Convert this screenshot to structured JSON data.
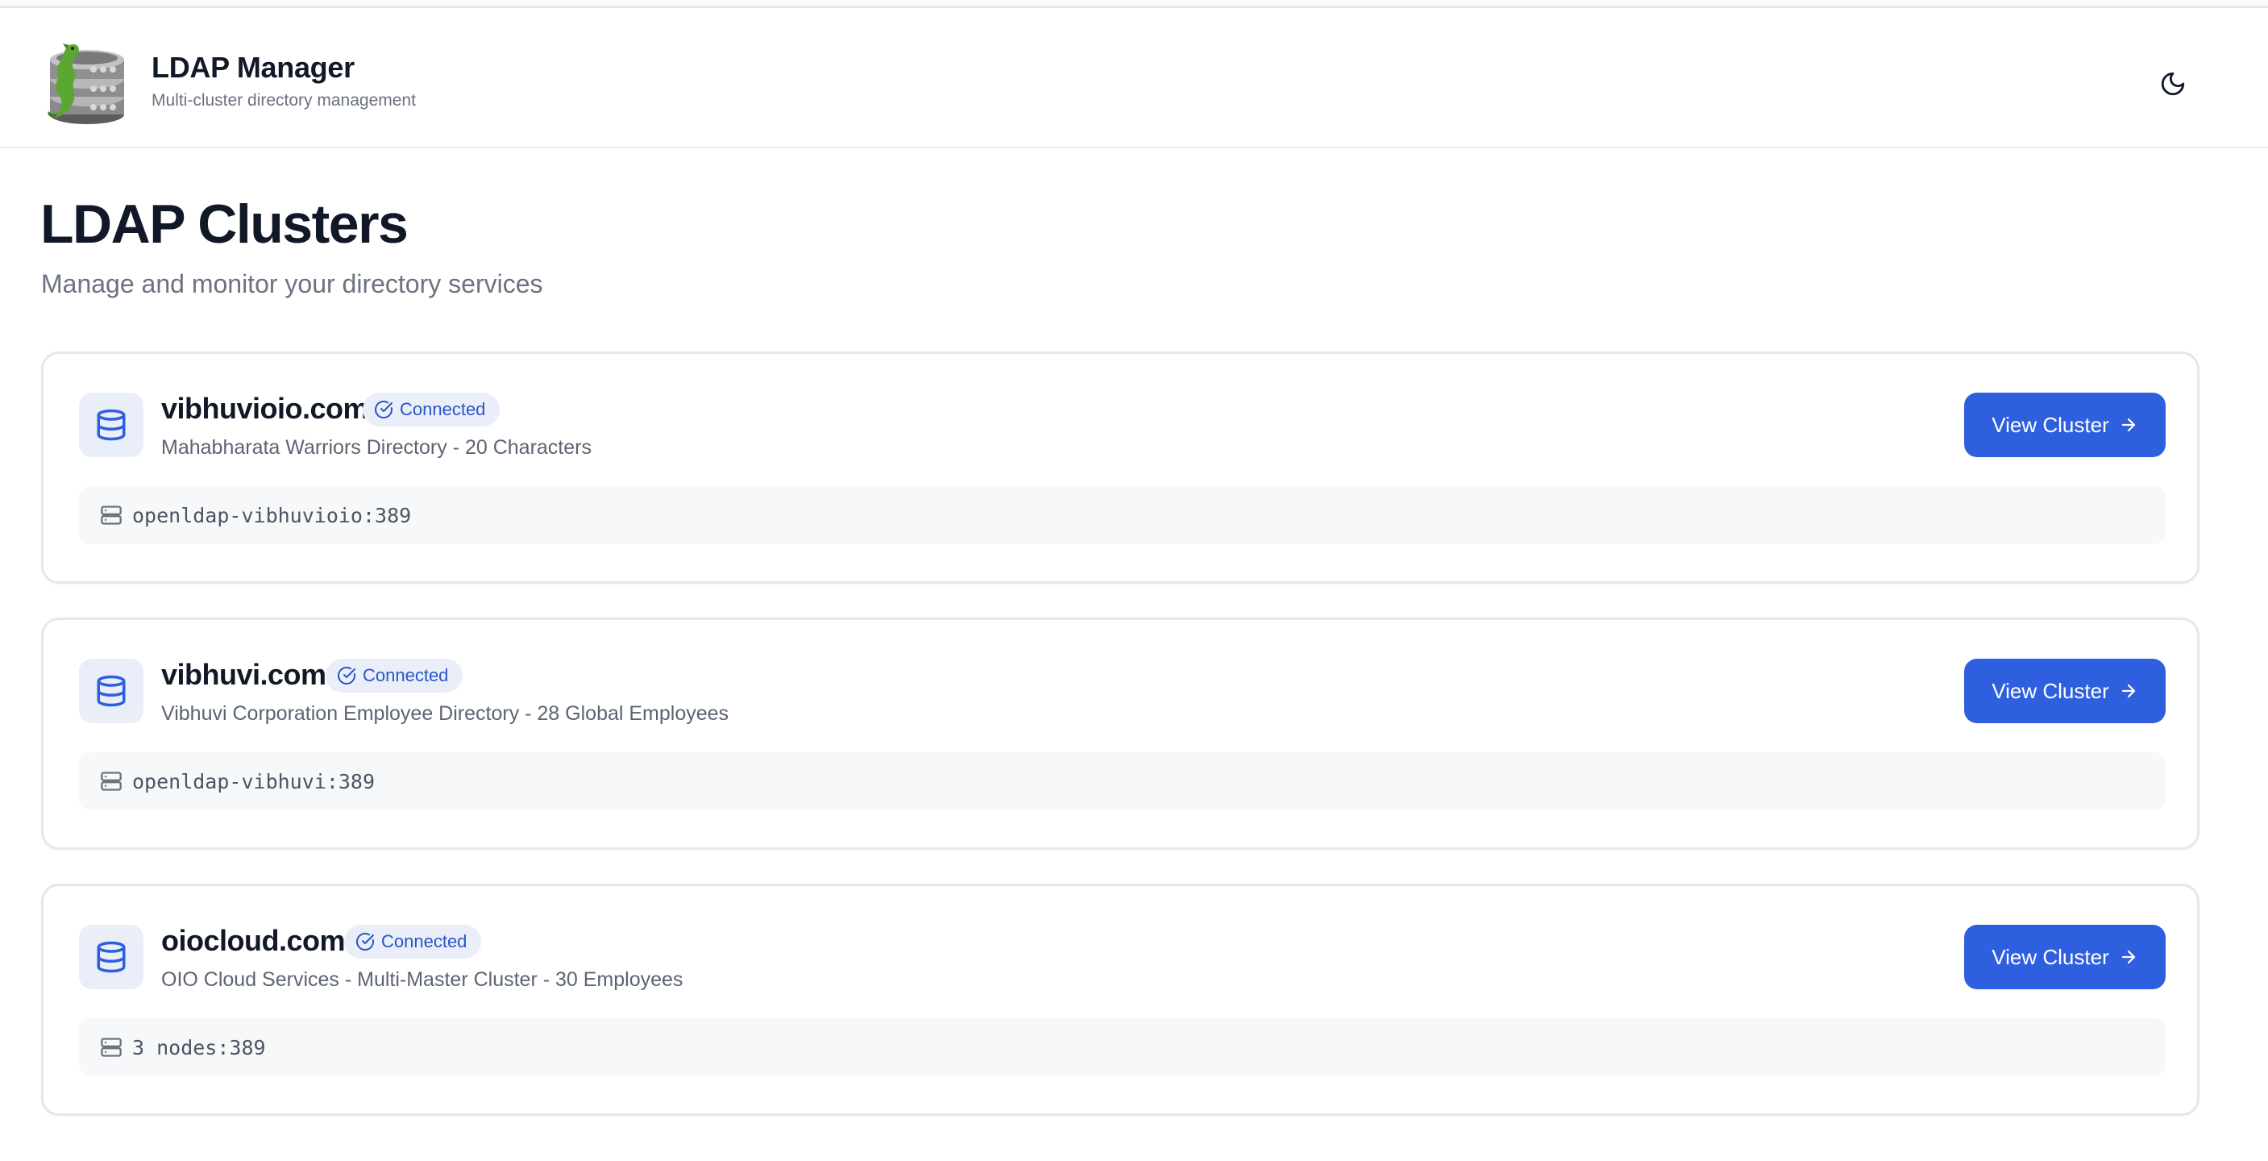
{
  "header": {
    "title": "LDAP Manager",
    "subtitle": "Multi-cluster directory management",
    "logo_icon": "ldap-server-stack-with-dragon-logo",
    "theme_toggle_icon": "moon-icon"
  },
  "page": {
    "title": "LDAP Clusters",
    "subtitle": "Manage and monitor your directory services"
  },
  "colors": {
    "primary": "#2e5fde",
    "badge_bg": "#eaeef8",
    "badge_text": "#2856c7",
    "muted_text": "#6b7280",
    "border": "#e5e7eb"
  },
  "clusters": [
    {
      "name": "vibhuvioio.com",
      "status": "Connected",
      "description": "Mahabharata Warriors Directory - 20 Characters",
      "endpoint": "openldap-vibhuvioio:389",
      "button_label": "View Cluster",
      "icon": "database-icon",
      "endpoint_icon": "server-icon"
    },
    {
      "name": "vibhuvi.com",
      "status": "Connected",
      "description": "Vibhuvi Corporation Employee Directory - 28 Global Employees",
      "endpoint": "openldap-vibhuvi:389",
      "button_label": "View Cluster",
      "icon": "database-icon",
      "endpoint_icon": "server-icon"
    },
    {
      "name": "oiocloud.com",
      "status": "Connected",
      "description": "OIO Cloud Services - Multi-Master Cluster - 30 Employees",
      "endpoint": "3 nodes:389",
      "button_label": "View Cluster",
      "icon": "database-icon",
      "endpoint_icon": "server-icon"
    }
  ]
}
